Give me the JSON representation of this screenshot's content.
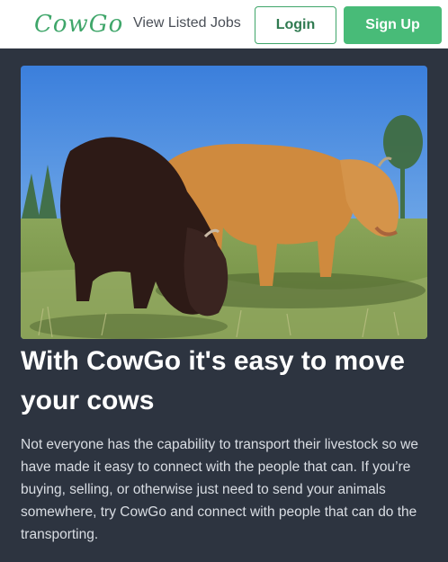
{
  "nav": {
    "logo": "CowGo",
    "view_jobs": "View Listed Jobs",
    "login": "Login",
    "signup": "Sign Up"
  },
  "hero": {
    "image_subject": "two-highland-cows-grazing"
  },
  "main": {
    "headline": "With CowGo it's easy to move your cows",
    "body": "Not everyone has the capability to transport their livestock so we have made it easy to connect with the people that can. If you’re buying, selling, or otherwise just need to send your animals somewhere, try CowGo and connect with people that can do the transporting."
  },
  "colors": {
    "brand_green": "#48bb78",
    "page_background": "#2d3440",
    "navbar_background": "#ffffff"
  }
}
